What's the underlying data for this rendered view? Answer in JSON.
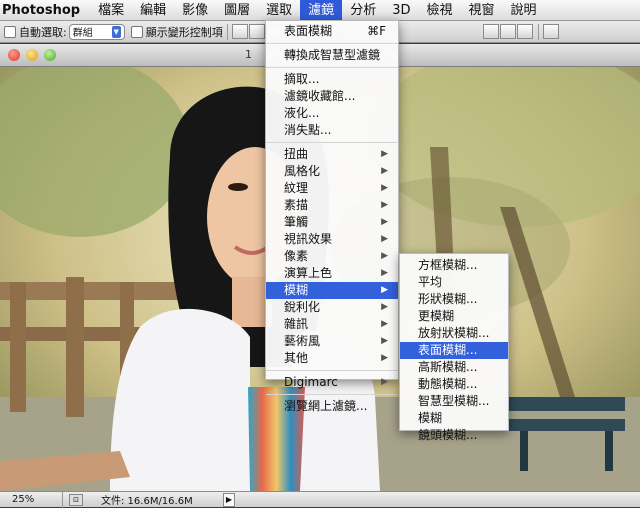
{
  "menubar": {
    "app": "Photoshop",
    "items": [
      "檔案",
      "編輯",
      "影像",
      "圖層",
      "選取",
      "濾鏡",
      "分析",
      "3D",
      "檢視",
      "視窗",
      "說明"
    ],
    "active_index": 5
  },
  "options": {
    "auto_select_label": "自動選取:",
    "auto_select_value": "群組",
    "show_transform_label": "顯示變形控制項"
  },
  "document": {
    "title": "1"
  },
  "status": {
    "zoom": "25%",
    "file_info": "文件: 16.6M/16.6M"
  },
  "filter_menu": {
    "last_filter": "表面模糊",
    "last_filter_shortcut": "⌘F",
    "convert_smart": "轉換成智慧型濾鏡",
    "extract": "摘取...",
    "gallery": "濾鏡收藏館...",
    "liquify": "液化...",
    "vanishing": "消失點...",
    "submenus": [
      "扭曲",
      "風格化",
      "紋理",
      "素描",
      "筆觸",
      "視訊效果",
      "像素",
      "演算上色",
      "模糊",
      "銳利化",
      "雜訊",
      "藝術風",
      "其他"
    ],
    "highlight_index": 8,
    "digimarc": "Digimarc",
    "browse_online": "瀏覽網上濾鏡..."
  },
  "blur_menu": {
    "items": [
      "方框模糊...",
      "平均",
      "形狀模糊...",
      "更模糊",
      "放射狀模糊...",
      "表面模糊...",
      "高斯模糊...",
      "動態模糊...",
      "智慧型模糊...",
      "模糊",
      "鏡頭模糊..."
    ],
    "highlight_index": 5
  },
  "colors": {
    "menu_highlight": "#3360db",
    "menubar_active": "#2f5ad9"
  }
}
